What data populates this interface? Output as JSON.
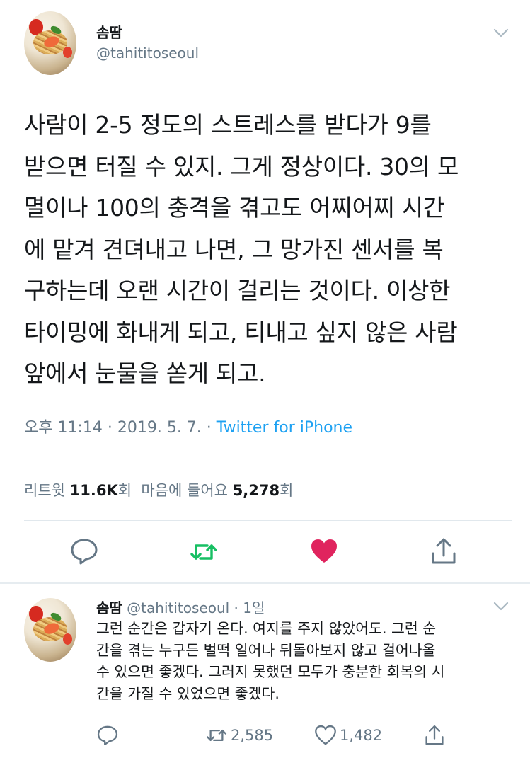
{
  "main_tweet": {
    "author_name": "솜땀",
    "author_handle": "@tahititoseoul",
    "text_lines": [
      "사람이 2-5 정도의 스트레스를 받다가 9를",
      "받으면 터질 수 있지. 그게 정상이다. 30의 모",
      "멸이나 100의 충격을 겪고도 어찌어찌 시간",
      "에 맡겨 견뎌내고 나면, 그 망가진 센서를 복",
      "구하는데 오랜 시간이 걸리는 것이다. 이상한",
      "타이밍에 화내게 되고, 티내고 싶지 않은 사람",
      "앞에서 눈물을 쏟게 되고."
    ],
    "timestamp": "오후 11:14 · 2019. 5. 7. · ",
    "source": "Twitter for iPhone",
    "retweet_label": "리트윗 ",
    "retweet_count": "11.6K",
    "retweet_suffix": "회  마음에 들어요 ",
    "like_count": "5,278",
    "like_suffix": "회",
    "actions": {
      "reply_icon": "reply-icon",
      "retweet_icon": "retweet-icon",
      "like_icon": "heart-icon",
      "share_icon": "share-icon",
      "retweet_color": "#17bf63",
      "like_color": "#e0245e"
    }
  },
  "reply_tweet": {
    "author_name": "솜땀",
    "author_handle": "@tahititoseoul · 1일",
    "text_lines": [
      "그런 순간은 갑자기 온다. 여지를 주지 않았어도. 그런 순",
      "간을 겪는 누구든 벌떡 일어나 뒤돌아보지 않고 걸어나올",
      "수 있으면 좋겠다. 그러지 못했던 모두가 충분한 회복의 시",
      "간을 가질 수 있었으면 좋겠다."
    ],
    "retweet_count": "2,585",
    "like_count": "1,482"
  }
}
